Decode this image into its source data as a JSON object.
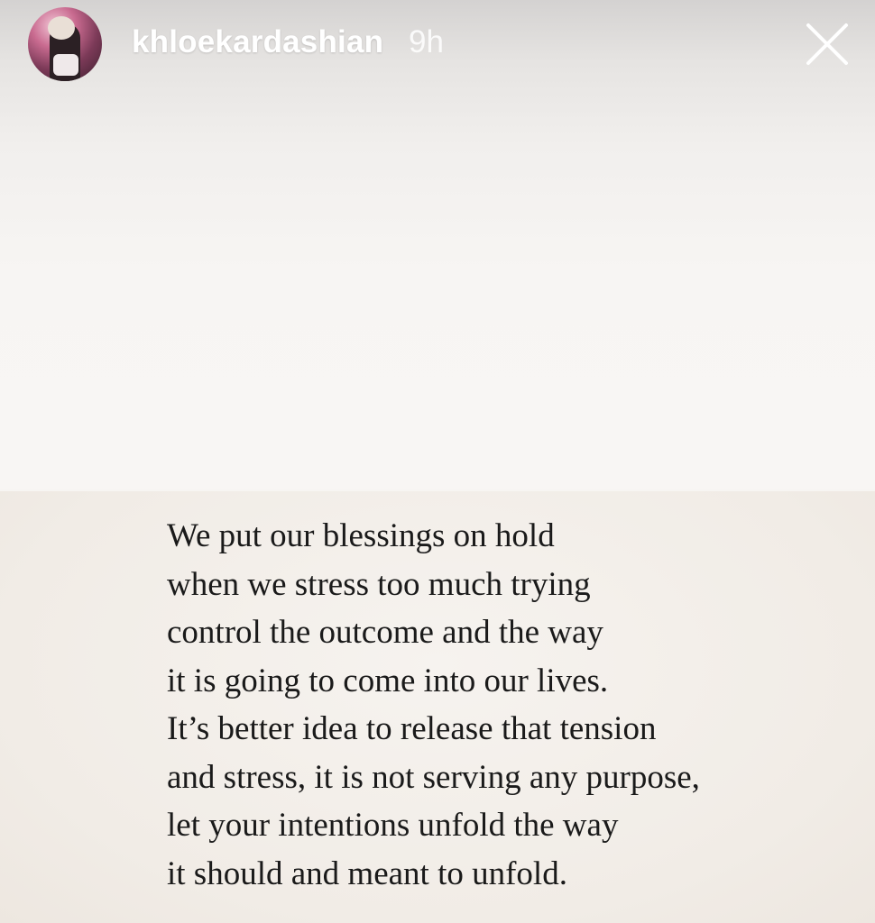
{
  "header": {
    "username": "khloekardashian",
    "timestamp": "9h",
    "avatar_icon": "profile-photo",
    "close_icon": "close-icon"
  },
  "story": {
    "quote_lines": [
      "We put our blessings on hold",
      "when we stress too much trying",
      "control the outcome and the way",
      "it is going to come into our lives.",
      "It’s better idea to release that tension",
      "and stress, it is not serving any purpose,",
      "let your intentions unfold the way",
      "it should and meant to unfold."
    ]
  },
  "colors": {
    "text": "#1a1a1a",
    "header_text": "#ffffff",
    "background": "#f6f3f1"
  }
}
